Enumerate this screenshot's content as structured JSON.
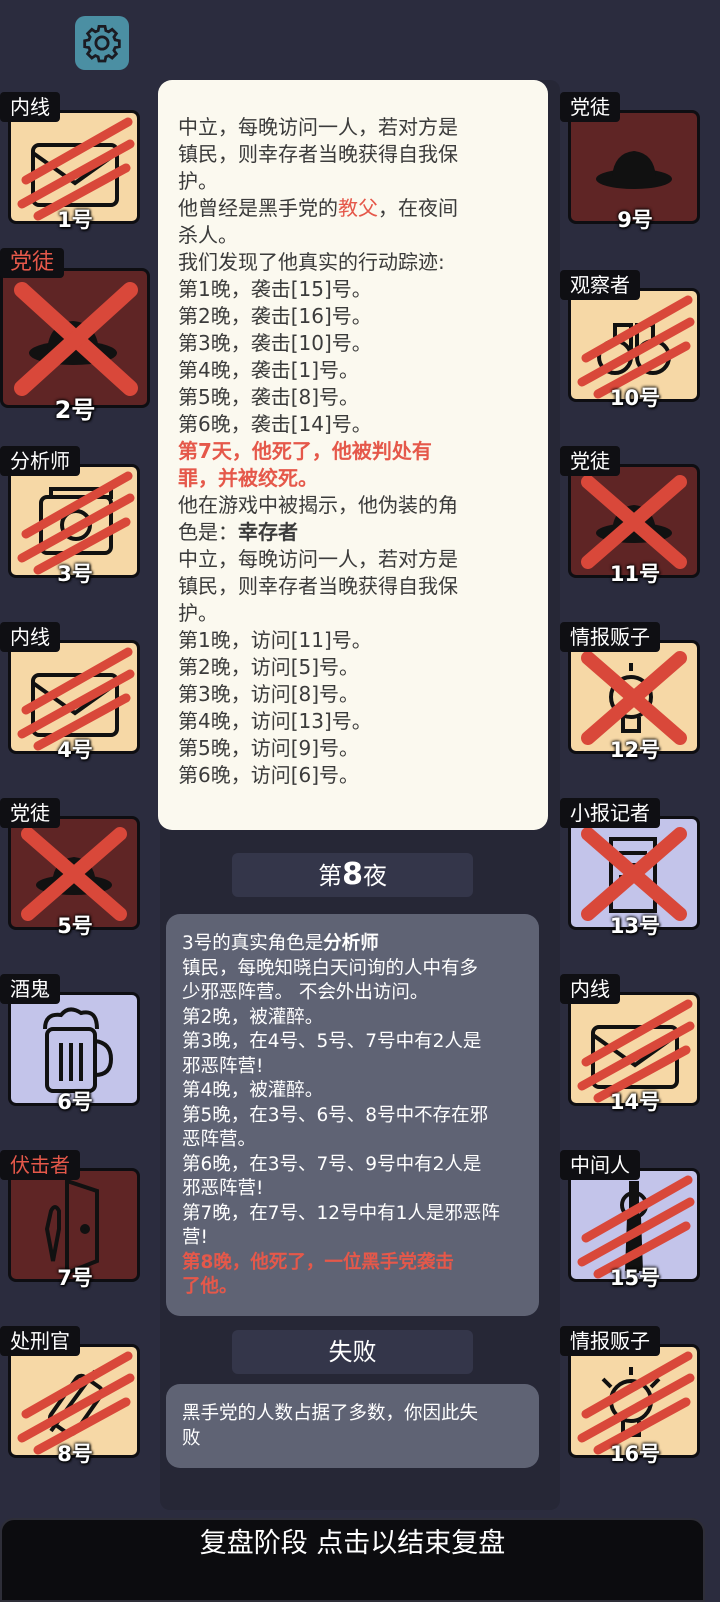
{
  "settings": {
    "icon": "gear-icon"
  },
  "left_players": [
    {
      "role": "内线",
      "number": "1号",
      "role_color": "white",
      "bg": "tan",
      "icon": "envelope-icon",
      "state": "claw"
    },
    {
      "role": "党徒",
      "number": "2号",
      "role_color": "red",
      "bg": "maroon",
      "icon": "hat-icon",
      "state": "x"
    },
    {
      "role": "分析师",
      "number": "3号",
      "role_color": "white",
      "bg": "tan",
      "icon": "photos-icon",
      "state": "claw"
    },
    {
      "role": "内线",
      "number": "4号",
      "role_color": "white",
      "bg": "tan",
      "icon": "envelope-icon",
      "state": "claw"
    },
    {
      "role": "党徒",
      "number": "5号",
      "role_color": "white",
      "bg": "maroon",
      "icon": "hat-icon",
      "state": "x"
    },
    {
      "role": "酒鬼",
      "number": "6号",
      "role_color": "white",
      "bg": "lav",
      "icon": "beer-icon",
      "state": "none"
    },
    {
      "role": "伏击者",
      "number": "7号",
      "role_color": "red",
      "bg": "maroon",
      "icon": "door-knife-icon",
      "state": "none"
    },
    {
      "role": "处刑官",
      "number": "8号",
      "role_color": "white",
      "bg": "tan",
      "icon": "scroll-icon",
      "state": "claw"
    }
  ],
  "right_players": [
    {
      "role": "党徒",
      "number": "9号",
      "role_color": "white",
      "bg": "maroon",
      "icon": "hat-icon",
      "state": "none"
    },
    {
      "role": "观察者",
      "number": "10号",
      "role_color": "white",
      "bg": "tan",
      "icon": "binoculars-icon",
      "state": "claw"
    },
    {
      "role": "党徒",
      "number": "11号",
      "role_color": "white",
      "bg": "maroon",
      "icon": "hat-icon",
      "state": "x"
    },
    {
      "role": "情报贩子",
      "number": "12号",
      "role_color": "white",
      "bg": "tan",
      "icon": "lightbulb-icon",
      "state": "x"
    },
    {
      "role": "小报记者",
      "number": "13号",
      "role_color": "white",
      "bg": "lav",
      "icon": "paper-icon",
      "state": "x"
    },
    {
      "role": "内线",
      "number": "14号",
      "role_color": "white",
      "bg": "tan",
      "icon": "envelope-icon",
      "state": "claw"
    },
    {
      "role": "中间人",
      "number": "15号",
      "role_color": "white",
      "bg": "lav",
      "icon": "silhouette-icon",
      "state": "claw"
    },
    {
      "role": "情报贩子",
      "number": "16号",
      "role_color": "white",
      "bg": "tan",
      "icon": "lightbulb-icon",
      "state": "claw"
    }
  ],
  "popup": {
    "l1": "中立，每晚访问一人，若对方是",
    "l2": "镇民，则幸存者当晚获得自我保",
    "l3": "护。",
    "l4_a": "他曾经是黑手党的",
    "l4_b": "教父",
    "l4_c": "，在夜间",
    "l5": "杀人。",
    "l6": "我们发现了他真实的行动踪迹:",
    "l7": "第1晚，袭击[15]号。",
    "l8": "第2晚，袭击[16]号。",
    "l9": "第3晚，袭击[10]号。",
    "l10": "第4晚，袭击[1]号。",
    "l11": "第5晚，袭击[8]号。",
    "l12": "第6晚，袭击[14]号。",
    "l13": "第7天，他死了，他被判处有",
    "l14": "罪，并被绞死。",
    "l15": "他在游戏中被揭示，他伪装的角",
    "l16_a": "色是：",
    "l16_b": "幸存者",
    "l17": "中立，每晚访问一人，若对方是",
    "l18": "镇民，则幸存者当晚获得自我保",
    "l19": "护。",
    "l20": "第1晚，访问[11]号。",
    "l21": "第2晚，访问[5]号。",
    "l22": "第3晚，访问[8]号。",
    "l23": "第4晚，访问[13]号。",
    "l24": "第5晚，访问[9]号。",
    "l25": "第6晚，访问[6]号。"
  },
  "night_bar": {
    "prefix": "第",
    "number": "8",
    "suffix": "夜"
  },
  "night_panel": {
    "l1_a": "3号的真实角色是",
    "l1_b": "分析师",
    "l2": "镇民，每晚知晓白天问询的人中有多",
    "l3": "少邪恶阵营。 不会外出访问。",
    "l4": "第2晚，被灌醉。",
    "l5": "第3晚，在4号、5号、7号中有2人是",
    "l6": "邪恶阵营!",
    "l7": "第4晚，被灌醉。",
    "l8": "第5晚，在3号、6号、8号中不存在邪",
    "l9": "恶阵营。",
    "l10": "第6晚，在3号、7号、9号中有2人是",
    "l11": "邪恶阵营!",
    "l12": "第7晚，在7号、12号中有1人是邪恶阵",
    "l13": "营!",
    "l14": "第8晚，他死了，一位黑手党袭击",
    "l15": "了他。"
  },
  "result_bar": {
    "label": "失败"
  },
  "result_panel": {
    "l1": "黑手党的人数占据了多数，你因此失",
    "l2": "败"
  },
  "bottom_bar": {
    "label": "复盘阶段 点击以结束复盘"
  },
  "colors": {
    "accent_red": "#e5584a",
    "tan": "#f6d8a6",
    "maroon": "#5f2525",
    "lavender": "#c3c4ea",
    "background": "#2b2c3e"
  }
}
